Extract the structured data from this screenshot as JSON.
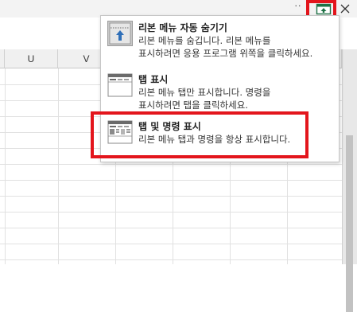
{
  "titlebar": {
    "more_label": "··",
    "ribbon_options_icon": "ribbon-display-options-icon",
    "close_icon": "close-icon"
  },
  "sheet": {
    "columns": [
      "",
      "U",
      "V",
      "",
      "",
      "",
      "",
      ""
    ]
  },
  "menu": {
    "items": [
      {
        "title": "리본 메뉴 자동 숨기기",
        "desc_line1": "리본 메뉴를 숨깁니다. 리본 메뉴를",
        "desc_line2": "표시하려면 응용 프로그램 위쪽을 클릭하세요.",
        "icon": "auto-hide-ribbon-icon"
      },
      {
        "title": "탭 표시",
        "desc_line1": "리본 메뉴 탭만 표시합니다. 명령을",
        "desc_line2": "표시하려면 탭을 클릭하세요.",
        "icon": "show-tabs-icon"
      },
      {
        "title": "탭 및 명령 표시",
        "desc_line1": "리본 메뉴 탭과 명령을 항상 표시합니다.",
        "icon": "show-tabs-and-commands-icon"
      }
    ]
  },
  "colors": {
    "highlight": "#e3151c",
    "ribbon_icon_green": "#1e7145"
  }
}
